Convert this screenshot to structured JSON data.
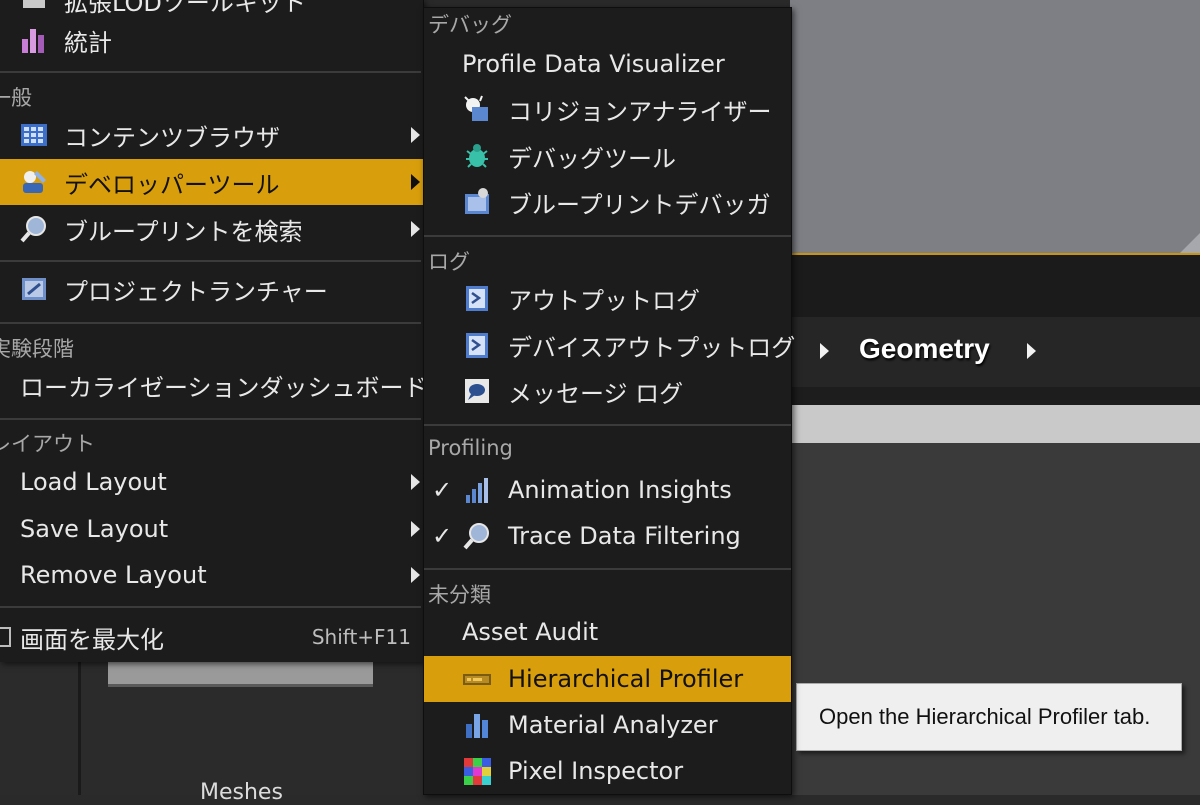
{
  "background": {
    "breadcrumb": {
      "label": "Geometry"
    },
    "content_label": "Meshes",
    "tooltip": "Open the Hierarchical Profiler tab."
  },
  "left_menu": {
    "top_partial_label": "拡張LODツールキット",
    "stats_label": "統計",
    "section_general": "一般",
    "content_browser": "コンテンツブラウザ",
    "developer_tools": "デベロッパーツール",
    "find_blueprint": "ブループリントを検索",
    "project_launcher": "プロジェクトランチャー",
    "section_experimental": "実験段階",
    "localization_dashboard": "ローカライゼーションダッシュボード",
    "section_layout": "レイアウト",
    "load_layout": "Load Layout",
    "save_layout": "Save Layout",
    "remove_layout": "Remove Layout",
    "maximize": "画面を最大化",
    "maximize_shortcut": "Shift+F11"
  },
  "sub_menu": {
    "section_debug": "デバッグ",
    "profile_visualizer": "Profile Data Visualizer",
    "collision_analyzer": "コリジョンアナライザー",
    "debug_tools": "デバッグツール",
    "blueprint_debugger": "ブループリントデバッガ",
    "section_log": "ログ",
    "output_log": "アウトプットログ",
    "device_output_log": "デバイスアウトプットログ",
    "message_log": "メッセージ ログ",
    "section_profiling": "Profiling",
    "animation_insights": "Animation Insights",
    "trace_filtering": "Trace Data Filtering",
    "check_mark": "✓",
    "section_misc": "未分類",
    "asset_audit": "Asset Audit",
    "hierarchical_profiler": "Hierarchical Profiler",
    "material_analyzer": "Material Analyzer",
    "pixel_inspector": "Pixel Inspector"
  },
  "colors": {
    "highlight": "#d99e0b",
    "menu_bg": "#1c1c1c"
  }
}
